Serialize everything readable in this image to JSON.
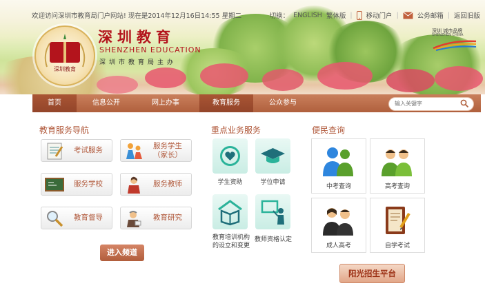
{
  "topbar": {
    "welcome": "欢迎访问深圳市教育局门户网站! 现在是2014年12月16日14:55 星期二",
    "switch_label": "切换：",
    "english": "ENGLISH",
    "traditional": "繁体版",
    "mobile": "移动门户",
    "email": "公务邮箱",
    "old_version": "返回旧版"
  },
  "logo": {
    "emblem_text": "深圳教育",
    "title_cn": "深圳教育",
    "title_en": "SHENZHEN EDUCATION",
    "subtitle": "深圳市教育局主办",
    "city_logo_cn": "深圳 城市品牌",
    "city_logo_en": "SHENZHEN CHINA"
  },
  "nav": {
    "items": [
      {
        "label": "首页",
        "active": true
      },
      {
        "label": "信息公开",
        "active": false
      },
      {
        "label": "网上办事",
        "active": false
      },
      {
        "label": "教育服务",
        "active": true
      },
      {
        "label": "公众参与",
        "active": false
      }
    ],
    "search_placeholder": "输入关键字"
  },
  "guide": {
    "title": "教育服务导航",
    "buttons": [
      {
        "label": "考试服务",
        "icon": "exam-icon"
      },
      {
        "label": "服务学生（家长）",
        "line1": "服务学生",
        "line2": "（家长）",
        "icon": "students-icon"
      },
      {
        "label": "服务学校",
        "icon": "blackboard-icon"
      },
      {
        "label": "服务教师",
        "icon": "teacher-icon"
      },
      {
        "label": "教育督导",
        "icon": "magnifier-icon"
      },
      {
        "label": "教育研究",
        "icon": "researcher-icon"
      }
    ],
    "enter_label": "进入频道"
  },
  "key_services": {
    "title": "重点业务服务",
    "items": [
      {
        "label": "学生资助",
        "icon": "heart-icon"
      },
      {
        "label": "学位申请",
        "icon": "graduation-cap-icon"
      },
      {
        "label": "教育培训机构的设立和变更",
        "line1": "教育培训机构",
        "line2": "的设立和变更",
        "icon": "book-house-icon"
      },
      {
        "label": "教师资格认定",
        "icon": "presenter-icon"
      }
    ]
  },
  "convenience": {
    "title": "便民查询",
    "items": [
      {
        "label": "中考查询",
        "icon": "people-blue-icon"
      },
      {
        "label": "高考查询",
        "icon": "people-green-icon"
      },
      {
        "label": "成人高考",
        "icon": "adult-exam-icon"
      },
      {
        "label": "自学考试",
        "icon": "notebook-icon"
      }
    ],
    "platform_label": "阳光招生平台"
  },
  "colors": {
    "accent": "#b0583a",
    "nav": "#b0603d",
    "brand_red": "#b3141c",
    "teal_tile": "#c9ede4"
  }
}
